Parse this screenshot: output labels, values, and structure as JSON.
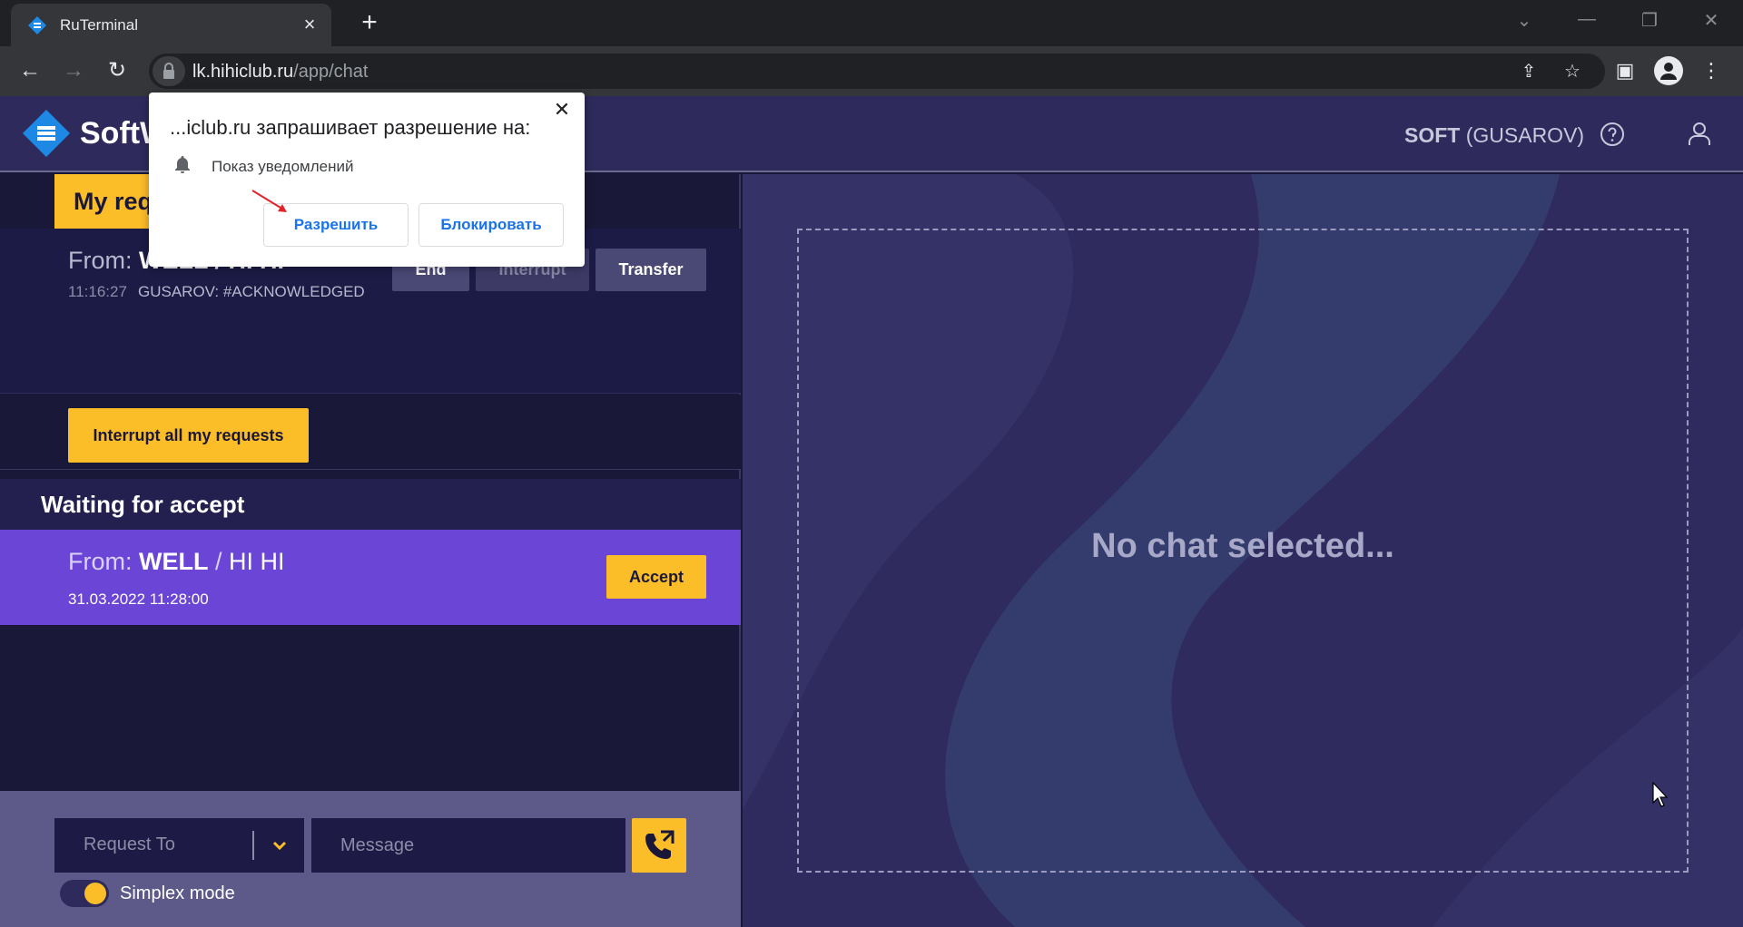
{
  "browser": {
    "tab_title": "RuTerminal",
    "url_prefix": "lk.hihiclub.ru",
    "url_path": "/app/chat"
  },
  "app": {
    "logo_text": "SoftW",
    "user_name": "SOFT",
    "user_sub": "(GUSAROV)"
  },
  "permission_popup": {
    "title": "...iclub.ru запрашивает разрешение на:",
    "item": "Показ уведомлений",
    "allow_label": "Разрешить",
    "block_label": "Блокировать"
  },
  "my_requests": {
    "tab_label": "My req",
    "request": {
      "from_label": "From:",
      "from_name": "WELL / HI HI",
      "time": "11:16:27",
      "status": "GUSAROV: #ACKNOWLEDGED"
    },
    "end_label": "End",
    "interrupt_label": "Interrupt",
    "transfer_label": "Transfer",
    "interrupt_all_label": "Interrupt all my requests"
  },
  "waiting": {
    "title": "Waiting for accept",
    "item": {
      "from_label": "From:",
      "from_name": "WELL",
      "from_sep": "/",
      "from_dest": "HI HI",
      "date": "31.03.2022 11:28:00",
      "accept_label": "Accept"
    }
  },
  "compose": {
    "request_to_placeholder": "Request To",
    "message_placeholder": "Message",
    "simplex_label": "Simplex mode",
    "simplex_on": true
  },
  "chat": {
    "empty_text": "No chat selected..."
  },
  "colors": {
    "accent": "#fbbd28",
    "waiting_item": "#6b45d6",
    "header": "#2e2a5c"
  }
}
